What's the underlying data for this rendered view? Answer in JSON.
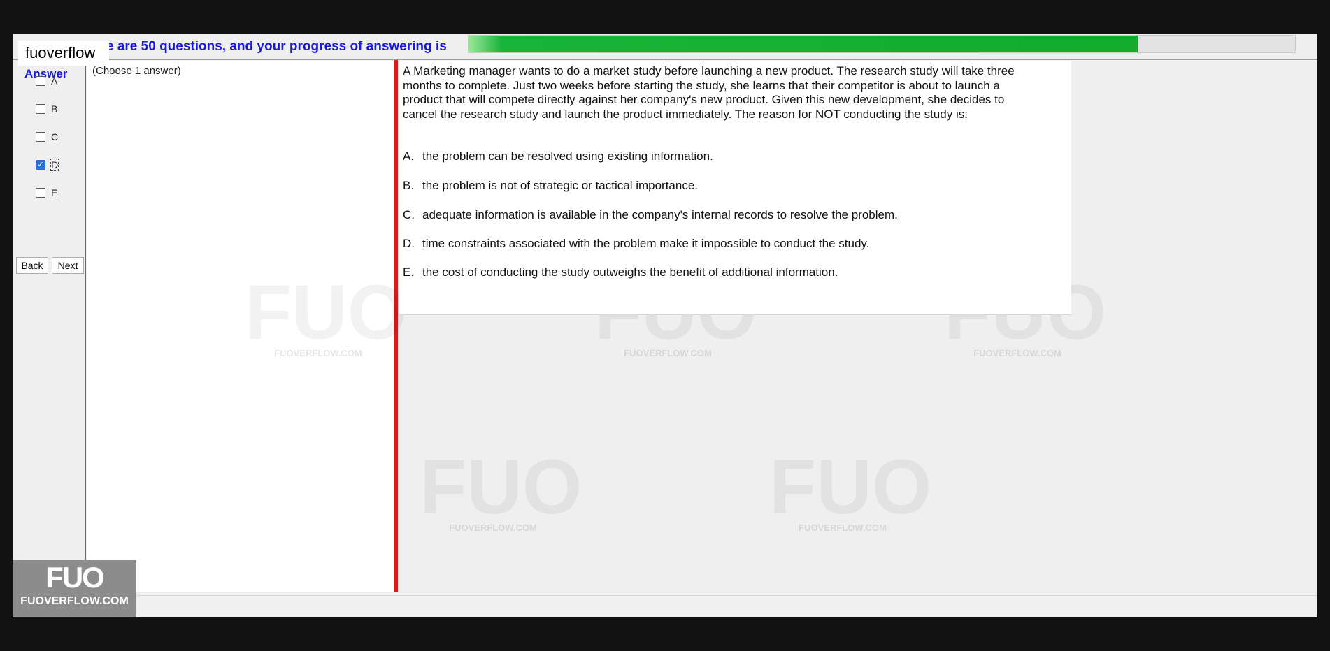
{
  "header": {
    "progress_text": "e are 50 questions, and your progress of answering is",
    "progress_fraction": 0.81,
    "brand_label": "fuoverflow"
  },
  "sidebar": {
    "answer_label": "Answer",
    "options": [
      {
        "label": "A",
        "checked": false
      },
      {
        "label": "B",
        "checked": false
      },
      {
        "label": "C",
        "checked": false
      },
      {
        "label": "D",
        "checked": true
      },
      {
        "label": "E",
        "checked": false
      }
    ],
    "back_label": "Back",
    "next_label": "Next"
  },
  "middle": {
    "choose_text": "(Choose 1 answer)"
  },
  "question": {
    "text": "A Marketing manager wants to do a market study before launching a new product. The research study will take three months to complete. Just two weeks before starting the study, she learns that their competitor is about to launch a product that will compete directly against her company's new product. Given this new development, she decides to cancel the research study and launch the product immediately. The reason for NOT conducting the study is:",
    "options": [
      {
        "letter": "A.",
        "text": "the problem can be resolved using existing information."
      },
      {
        "letter": "B.",
        "text": "the problem is not of strategic or tactical importance."
      },
      {
        "letter": "C.",
        "text": "adequate information is available in the company's internal records to resolve the problem."
      },
      {
        "letter": "D.",
        "text": "time constraints associated with the problem make it impossible to conduct the study."
      },
      {
        "letter": "E.",
        "text": "the cost of conducting the study outweighs the benefit of additional information."
      }
    ]
  },
  "watermark": {
    "mark": "FUO",
    "url": "FUOVERFLOW.COM"
  },
  "logo": {
    "mark": "FUO",
    "url": "FUOVERFLOW.COM"
  },
  "colors": {
    "accent_blue": "#1a1adf",
    "progress_green": "#12ab2c",
    "divider_red": "#e01818",
    "checkbox_checked": "#2a6fd6"
  }
}
